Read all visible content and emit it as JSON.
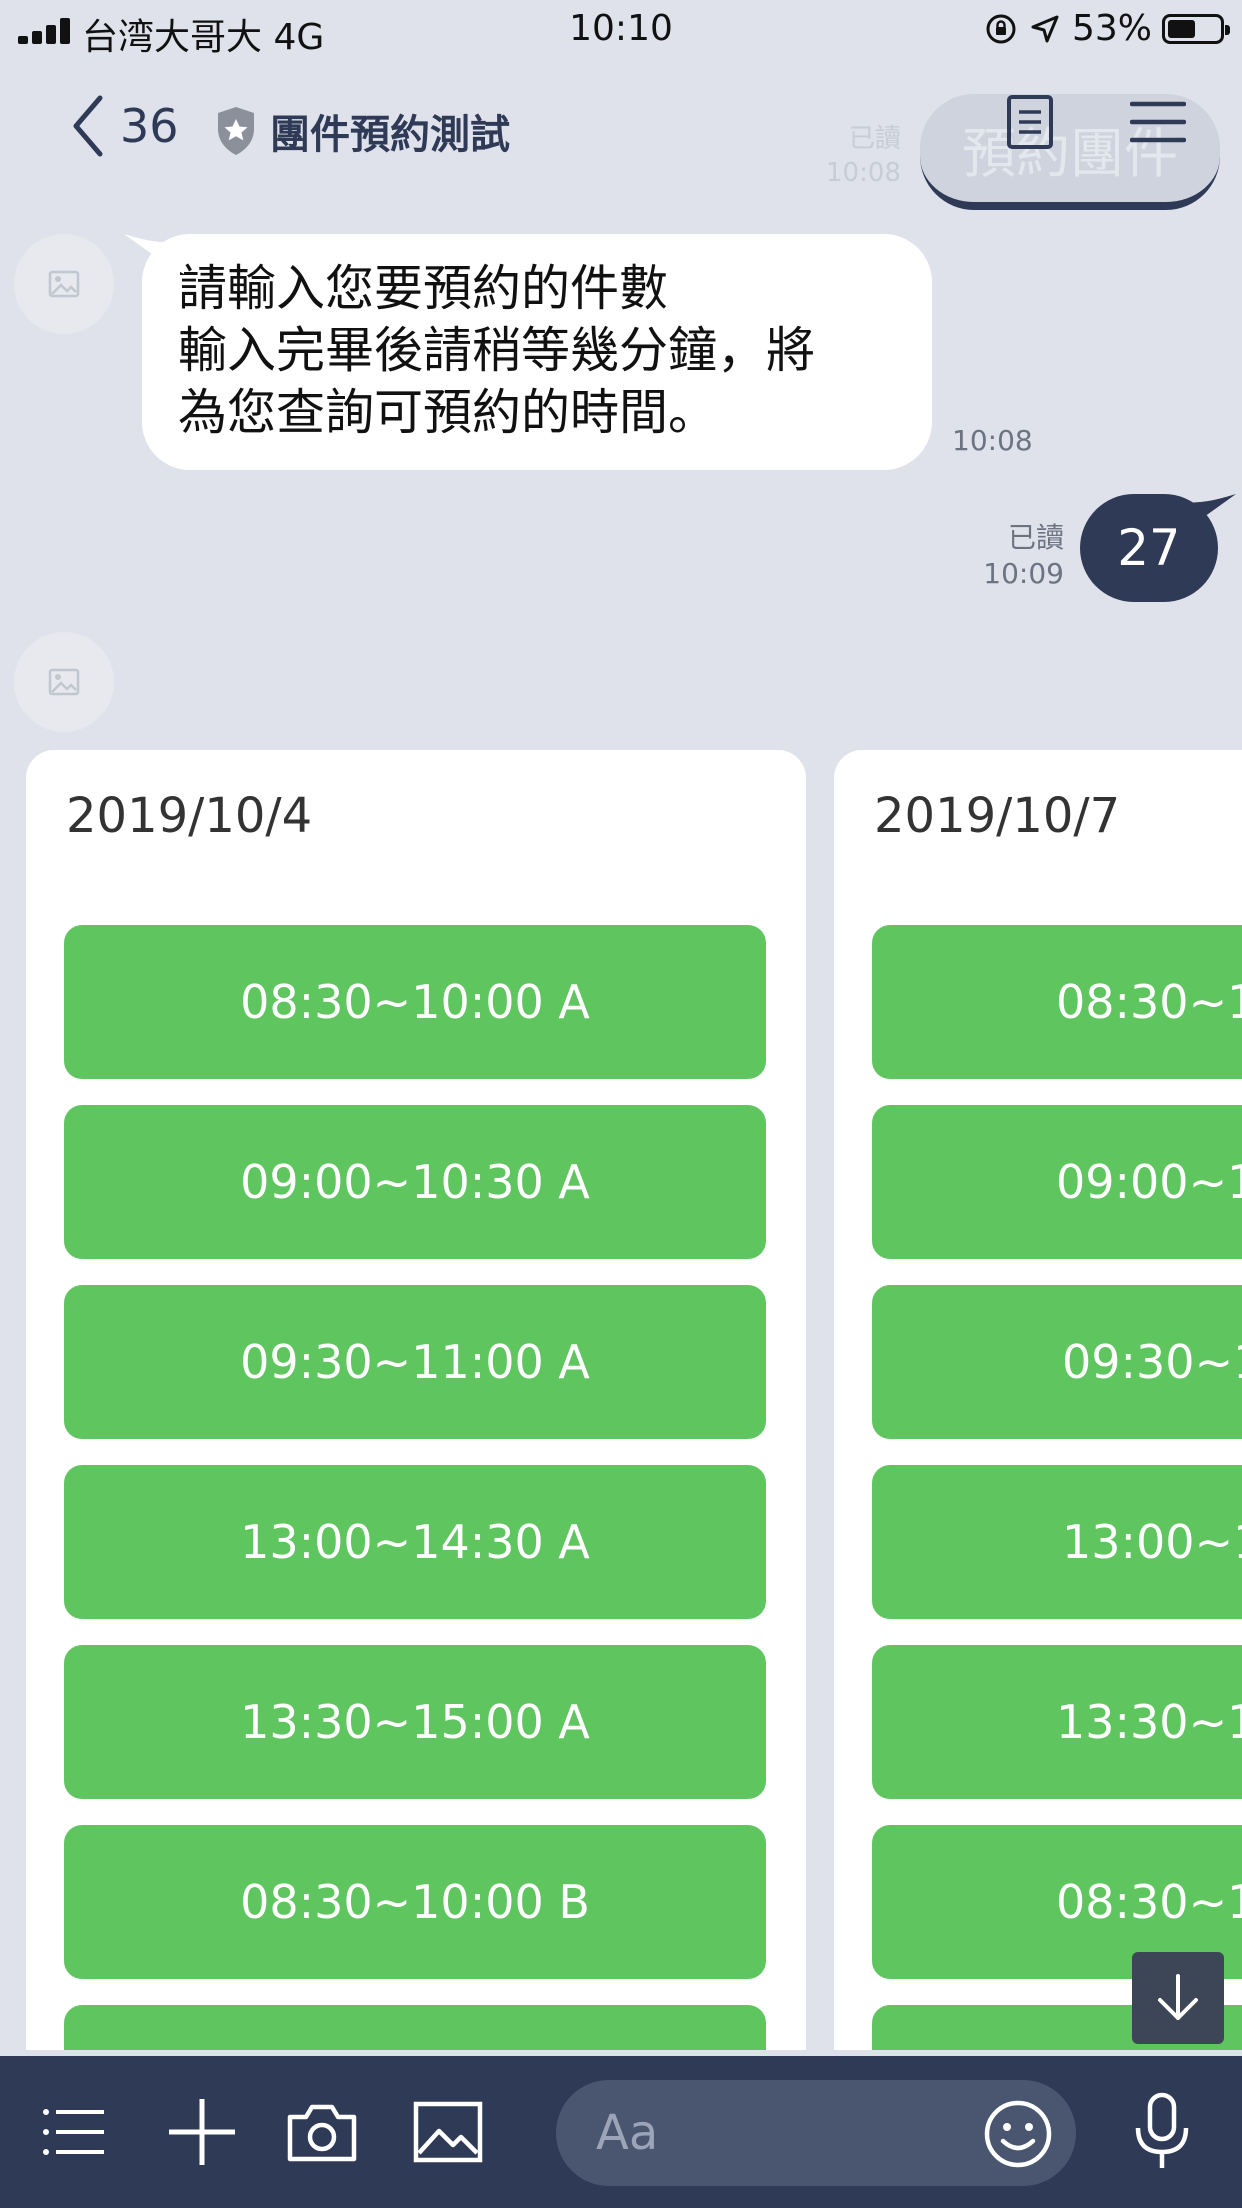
{
  "status_bar": {
    "carrier": "台湾大哥大 4G",
    "time": "10:10",
    "battery": "53%",
    "battery_level": 0.53
  },
  "header": {
    "unread_count": "36",
    "title": "團件預約測試"
  },
  "background": {
    "faded_button": "預約團件",
    "faded_read": "已讀",
    "faded_time": "10:08"
  },
  "messages": {
    "incoming": {
      "lines": [
        "請輸入您要預約的件數",
        "輸入完畢後請稍等幾分鐘，將",
        "為您查詢可預約的時間。"
      ],
      "time": "10:08"
    },
    "outgoing": {
      "text": "27",
      "read_label": "已讀",
      "time": "10:09"
    }
  },
  "carousel": {
    "cards": [
      {
        "date": "2019/10/4",
        "slots": [
          "08:30~10:00 A",
          "09:00~10:30 A",
          "09:30~11:00 A",
          "13:00~14:30 A",
          "13:30~15:00 A",
          "08:30~10:00 B",
          ""
        ]
      },
      {
        "date": "2019/10/7",
        "slots": [
          "08:30~1",
          "09:00~1",
          "09:30~1",
          "13:00~1",
          "13:30~1",
          "08:30~1",
          ""
        ]
      }
    ]
  },
  "input": {
    "placeholder": "Aa"
  },
  "colors": {
    "background": "#dfe2ea",
    "navy": "#2f3a57",
    "green": "#5ec55f"
  }
}
